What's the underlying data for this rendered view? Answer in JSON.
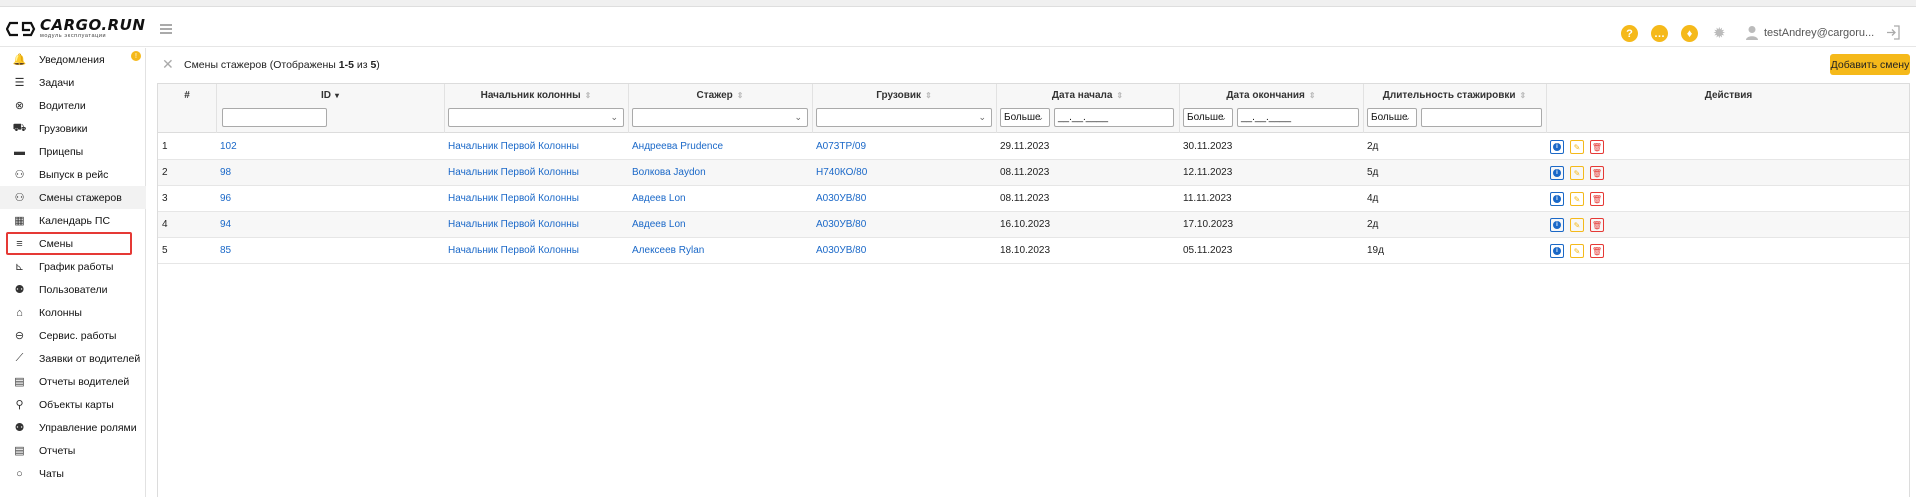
{
  "app": {
    "logo_title": "CARGO.RUN",
    "logo_subtitle": "модуль эксплуатации",
    "user_name": "testAndrey@cargoru..."
  },
  "header_icons": [
    "question-icon",
    "chat-icon",
    "fire-icon",
    "gear-icon",
    "user-icon",
    "logout-icon"
  ],
  "header_icon_glyphs": {
    "question": "?",
    "chat": "…",
    "fire": "♦"
  },
  "colors": {
    "accent": "#f5b91a",
    "link": "#1a68c8",
    "danger": "#e53935"
  },
  "sidebar": {
    "notification_badge": "!",
    "items": [
      {
        "label": "Уведомления",
        "icon": "bell-icon",
        "glyph": "🔔"
      },
      {
        "label": "Задачи",
        "icon": "list-icon",
        "glyph": "☰"
      },
      {
        "label": "Водители",
        "icon": "steering-wheel-icon",
        "glyph": "⊗"
      },
      {
        "label": "Грузовики",
        "icon": "truck-icon",
        "glyph": "⛟"
      },
      {
        "label": "Прицепы",
        "icon": "trailer-icon",
        "glyph": "▬"
      },
      {
        "label": "Выпуск в рейс",
        "icon": "user-check-icon",
        "glyph": "⚇"
      },
      {
        "label": "Смены стажеров",
        "icon": "user-edit-icon",
        "glyph": "⚇"
      },
      {
        "label": "Календарь ПС",
        "icon": "calendar-truck-icon",
        "glyph": "▦"
      },
      {
        "label": "Смены",
        "icon": "bars-icon",
        "glyph": "≡"
      },
      {
        "label": "График работы",
        "icon": "chart-icon",
        "glyph": "⊾"
      },
      {
        "label": "Пользователи",
        "icon": "users-icon",
        "glyph": "⚉"
      },
      {
        "label": "Колонны",
        "icon": "warehouse-icon",
        "glyph": "⌂"
      },
      {
        "label": "Сервис. работы",
        "icon": "service-icon",
        "glyph": "⊖"
      },
      {
        "label": "Заявки от водителей",
        "icon": "wrench-icon",
        "glyph": "⟋"
      },
      {
        "label": "Отчеты водителей",
        "icon": "docs-icon",
        "glyph": "▤"
      },
      {
        "label": "Объекты карты",
        "icon": "map-objects-icon",
        "glyph": "⚲"
      },
      {
        "label": "Управление ролями",
        "icon": "roles-icon",
        "glyph": "⚉"
      },
      {
        "label": "Отчеты",
        "icon": "report-icon",
        "glyph": "▤"
      },
      {
        "label": "Чаты",
        "icon": "chat-bubble-icon",
        "glyph": "○"
      }
    ]
  },
  "toolbar": {
    "title_prefix": "Смены стажеров (Отображены ",
    "title_range": "1-5",
    "title_mid": " из ",
    "title_total": "5",
    "title_suffix": ")",
    "add_button": "Добавить смену"
  },
  "table": {
    "columns": [
      {
        "title": "#",
        "sortable": false
      },
      {
        "title": "ID",
        "sortable": true,
        "sorted": "desc"
      },
      {
        "title": "Начальник колонны",
        "sortable": true
      },
      {
        "title": "Стажер",
        "sortable": true
      },
      {
        "title": "Грузовик",
        "sortable": true
      },
      {
        "title": "Дата начала",
        "sortable": true
      },
      {
        "title": "Дата окончания",
        "sortable": true
      },
      {
        "title": "Длительность стажировки",
        "sortable": true
      },
      {
        "title": "Действия",
        "sortable": false
      }
    ],
    "filters": {
      "op_label": "Больше",
      "date_placeholder": "__.__.____",
      "sort_asc_desc_glyph": "⇕",
      "sort_down_glyph": "▾",
      "chevron_glyph": "⌄"
    },
    "rows": [
      {
        "num": "1",
        "id": "102",
        "chief": "Начальник Первой Колонны",
        "trainee": "Андреева Prudence",
        "truck": "А073ТР/09",
        "start": "29.11.2023",
        "end": "30.11.2023",
        "duration": "2д"
      },
      {
        "num": "2",
        "id": "98",
        "chief": "Начальник Первой Колонны",
        "trainee": "Волкова Jaydon",
        "truck": "Н740КО/80",
        "start": "08.11.2023",
        "end": "12.11.2023",
        "duration": "5д"
      },
      {
        "num": "3",
        "id": "96",
        "chief": "Начальник Первой Колонны",
        "trainee": "Авдеев Lon",
        "truck": "А030УВ/80",
        "start": "08.11.2023",
        "end": "11.11.2023",
        "duration": "4д"
      },
      {
        "num": "4",
        "id": "94",
        "chief": "Начальник Первой Колонны",
        "trainee": "Авдеев Lon",
        "truck": "А030УВ/80",
        "start": "16.10.2023",
        "end": "17.10.2023",
        "duration": "2д"
      },
      {
        "num": "5",
        "id": "85",
        "chief": "Начальник Первой Колонны",
        "trainee": "Алексеев Rylan",
        "truck": "А030УВ/80",
        "start": "18.10.2023",
        "end": "05.11.2023",
        "duration": "19д"
      }
    ],
    "action_glyphs": {
      "info": "i",
      "edit": "✎",
      "delete": "🗑"
    }
  }
}
